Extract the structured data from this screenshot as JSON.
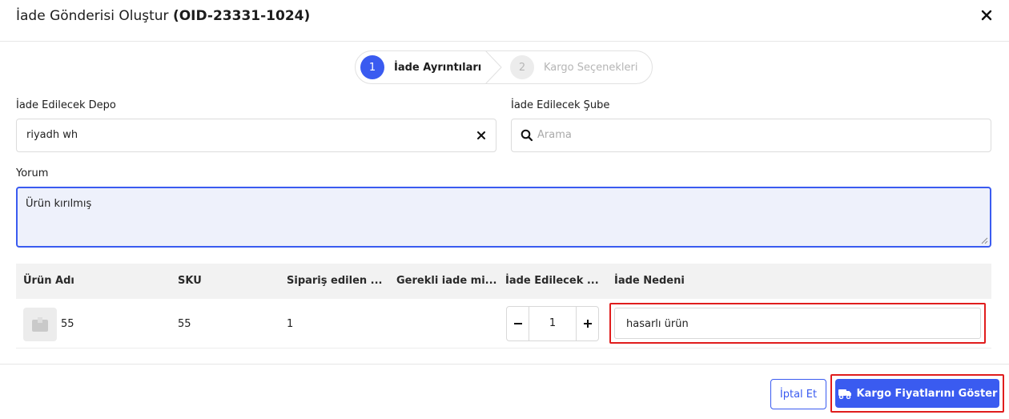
{
  "modal": {
    "title": "İade Gönderisi Oluştur",
    "order_id": "(OID-23331-1024)"
  },
  "steps": [
    {
      "number": "1",
      "label": "İade Ayrıntıları",
      "active": true
    },
    {
      "number": "2",
      "label": "Kargo Seçenekleri",
      "active": false
    }
  ],
  "form": {
    "warehouse_label": "İade Edilecek Depo",
    "warehouse_value": "riyadh wh",
    "branch_label": "İade Edilecek Şube",
    "branch_placeholder": "Arama",
    "comment_label": "Yorum",
    "comment_value": "Ürün kırılmış"
  },
  "table": {
    "headers": [
      "Ürün Adı",
      "SKU",
      "Sipariş edilen ...",
      "Gerekli iade mi...",
      "İade Edilecek ...",
      "İade Nedeni"
    ],
    "rows": [
      {
        "product_name": "55",
        "sku": "55",
        "ordered": "1",
        "required_return": "",
        "return_qty": "1",
        "reason": "hasarlı ürün"
      }
    ]
  },
  "footer": {
    "cancel_label": "İptal Et",
    "primary_label": "Kargo Fiyatlarını Göster"
  },
  "colors": {
    "accent": "#3a5bf0",
    "highlight": "#e01d1d",
    "textarea_bg": "#eef1fb"
  },
  "icons": {
    "close": "close-icon",
    "clear": "clear-icon",
    "search": "search-icon",
    "truck": "truck-icon"
  }
}
